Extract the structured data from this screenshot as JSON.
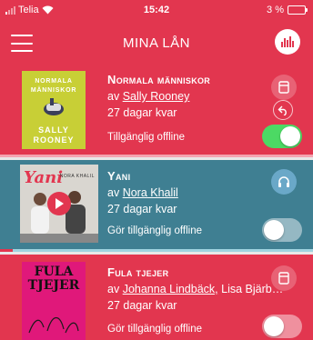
{
  "status": {
    "carrier": "Telia",
    "time": "15:42",
    "battery": "3 %"
  },
  "header": {
    "title": "MINA LÅN"
  },
  "books": [
    {
      "title": "Normala människor",
      "by": "av",
      "author": "Sally Rooney",
      "remaining": "27 dagar kvar",
      "offline_label": "Tillgänglig offline",
      "offline_on": true,
      "cover_title": "NORMALA MÄNNISKOR",
      "cover_author": "SALLY ROONEY",
      "icon": "ebook-icon",
      "extra_icon": "return-icon"
    },
    {
      "title": "Yani",
      "by": "av",
      "author": "Nora Khalil",
      "remaining": "27 dagar kvar",
      "offline_label": "Gör tillgänglig offline",
      "offline_on": false,
      "cover_title": "Yani",
      "cover_author": "NORA KHALIL",
      "icon": "headphones-icon",
      "listen_progress": 0.04
    },
    {
      "title": "Fula tjejer",
      "by": "av",
      "author": "Johanna Lindbäck,",
      "coauthors": "Lisa Bjärb…",
      "remaining": "27 dagar kvar",
      "offline_label": "Gör tillgänglig offline",
      "offline_on": false,
      "cover_title": "FULA TJEJER",
      "icon": "ebook-icon"
    }
  ]
}
